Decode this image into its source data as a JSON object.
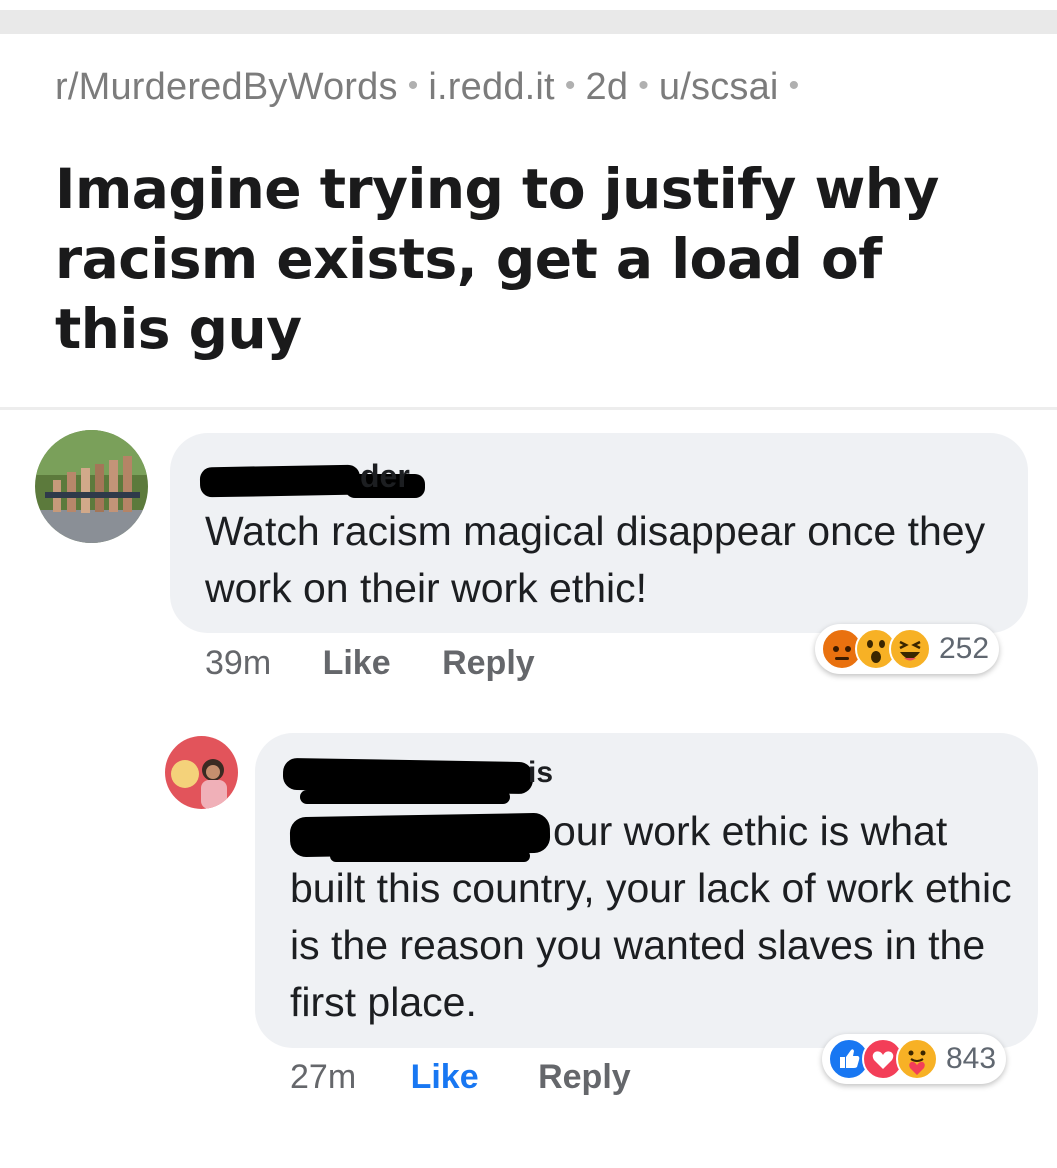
{
  "post": {
    "subreddit": "r/MurderedByWords",
    "domain": "i.redd.it",
    "age": "2d",
    "author": "u/scsai",
    "title": "Imagine trying to justify why racism exists, get a load of this guy"
  },
  "comments": [
    {
      "name_fragment": "der",
      "text": "Watch racism magical disappear once they work on their work ethic!",
      "time": "39m",
      "like_label": "Like",
      "reply_label": "Reply",
      "reactions": [
        "angry-icon",
        "wow-icon",
        "haha-icon"
      ],
      "reaction_count": "252"
    },
    {
      "name_fragment": "is",
      "text": "our work ethic is what built this country, your lack of work ethic is the reason you wanted slaves in the first place.",
      "time": "27m",
      "like_label": "Like",
      "reply_label": "Reply",
      "liked": true,
      "reactions": [
        "like-icon",
        "love-icon",
        "care-icon"
      ],
      "reaction_count": "843"
    }
  ],
  "colors": {
    "like_blue": "#1877f2",
    "love_red": "#f33e58",
    "angry_orange": "#e9710f",
    "yellow": "#f7b125"
  }
}
